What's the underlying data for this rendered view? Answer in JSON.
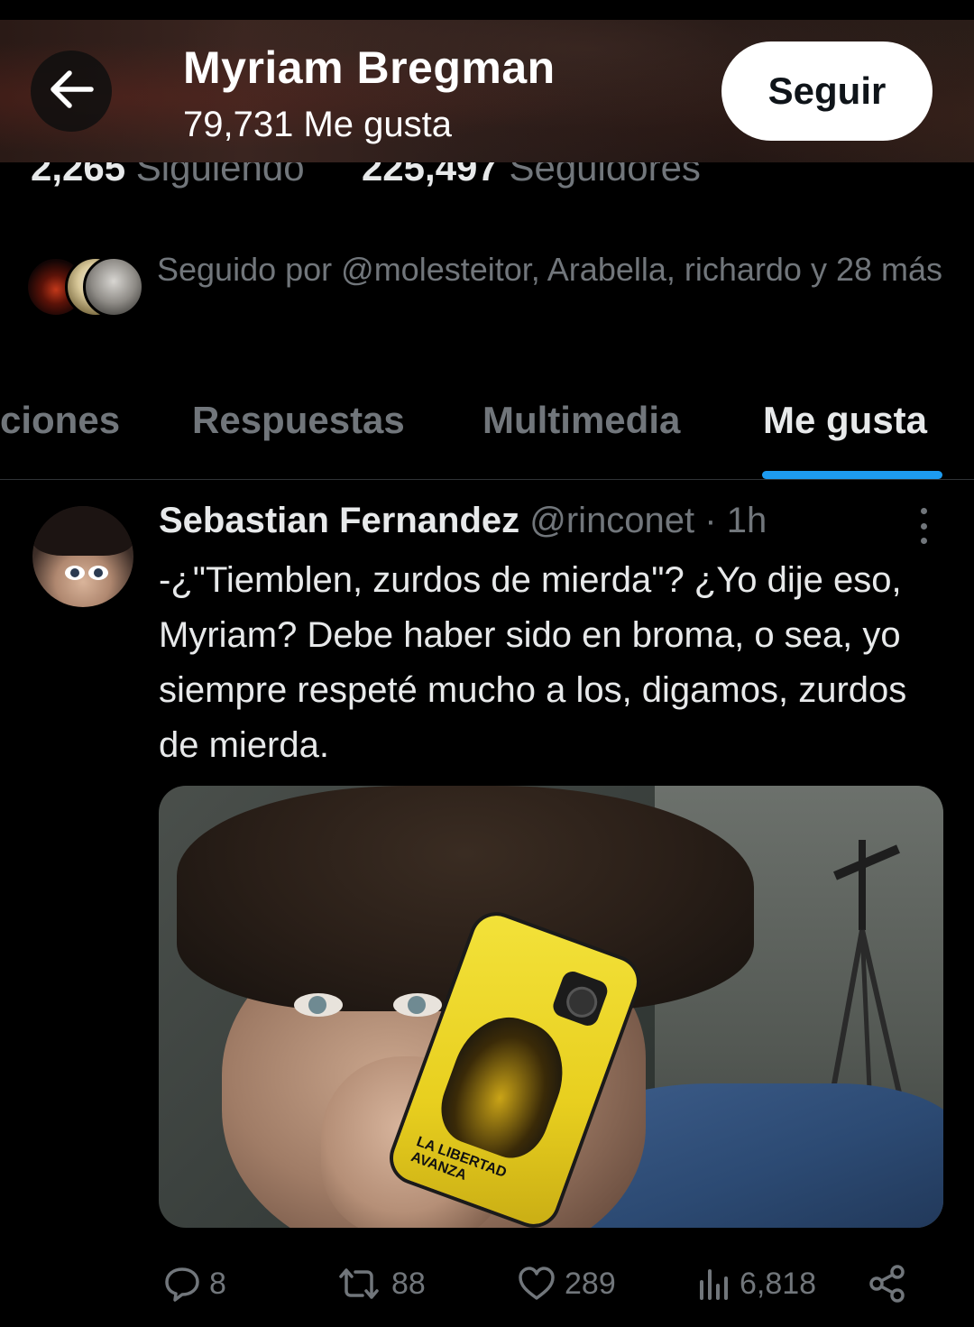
{
  "header": {
    "title": "Myriam Bregman",
    "subtitle": "79,731 Me gusta",
    "follow_label": "Seguir"
  },
  "stats": {
    "following_count": "2,265",
    "following_label": "Siguiendo",
    "followers_count": "225,497",
    "followers_label": "Seguidores"
  },
  "followed_by": {
    "text": "Seguido por @molesteitor, Arabella, richardo y 28 más"
  },
  "tabs": [
    {
      "label": "ciones"
    },
    {
      "label": "Respuestas"
    },
    {
      "label": "Multimedia"
    },
    {
      "label": "Me gusta",
      "active": true
    }
  ],
  "tweet": {
    "author_name": "Sebastian Fernandez",
    "author_handle": "@rinconet",
    "separator": "·",
    "time": "1h",
    "text": "-¿\"Tiemblen, zurdos de mierda\"? ¿Yo dije eso, Myriam? Debe haber sido en broma, o sea, yo siempre respeté mucho a los, digamos, zurdos de mierda.",
    "media_phone_caption": "LA LIBERTAD\nAVANZA",
    "actions": {
      "replies": "8",
      "retweets": "88",
      "likes": "289",
      "views": "6,818"
    }
  },
  "colors": {
    "background": "#000000",
    "text_primary": "#e7e9ea",
    "text_secondary": "#71767b",
    "accent": "#1d9bf0",
    "follow_button_bg": "#ffffff"
  },
  "icons": {
    "back": "arrow-left-icon",
    "more": "more-vertical-icon",
    "reply": "reply-icon",
    "retweet": "retweet-icon",
    "like": "heart-icon",
    "views": "views-icon",
    "share": "share-icon"
  }
}
